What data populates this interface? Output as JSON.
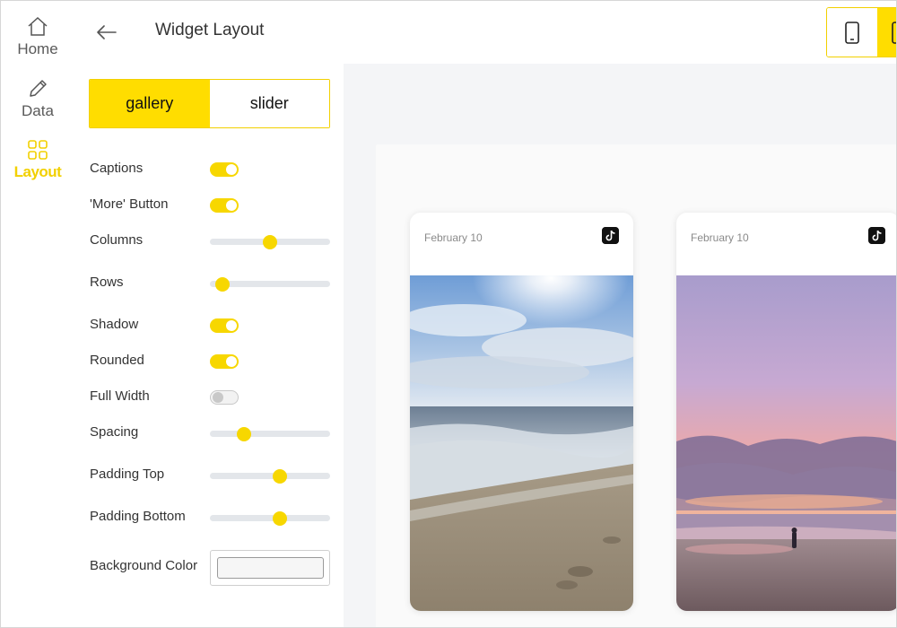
{
  "nav": {
    "items": [
      {
        "label": "Home",
        "icon": "home-icon"
      },
      {
        "label": "Data",
        "icon": "pencil-icon"
      },
      {
        "label": "Layout",
        "icon": "grid-icon",
        "active": true
      }
    ]
  },
  "header": {
    "title": "Widget Layout",
    "back_icon": "arrow-left-icon",
    "devices": [
      "phone-icon",
      "tablet-icon"
    ]
  },
  "layout_mode": {
    "options": [
      "gallery",
      "slider"
    ],
    "selected": "gallery"
  },
  "settings": {
    "captions": {
      "label": "Captions",
      "on": true
    },
    "more_button": {
      "label": "'More' Button",
      "on": true
    },
    "columns": {
      "label": "Columns",
      "level": 0.5
    },
    "rows": {
      "label": "Rows",
      "level": 0.05
    },
    "shadow": {
      "label": "Shadow",
      "on": true
    },
    "rounded": {
      "label": "Rounded",
      "on": true
    },
    "full_width": {
      "label": "Full Width",
      "on": false
    },
    "spacing": {
      "label": "Spacing",
      "level": 0.25
    },
    "padding_top": {
      "label": "Padding Top",
      "level": 0.59
    },
    "padding_bottom": {
      "label": "Padding Bottom",
      "level": 0.59
    },
    "background_color": {
      "label": "Background Color",
      "value": "#f6f6f6"
    }
  },
  "preview": {
    "cards": [
      {
        "date": "February 10",
        "source_icon": "tiktok-icon",
        "image": "beach-waves-sunny"
      },
      {
        "date": "February 10",
        "source_icon": "tiktok-icon",
        "image": "beach-sunset-purple"
      }
    ]
  },
  "colors": {
    "accent": "#ffdd00",
    "track": "#e3e6ea",
    "preview_bg": "#f4f5f7"
  }
}
